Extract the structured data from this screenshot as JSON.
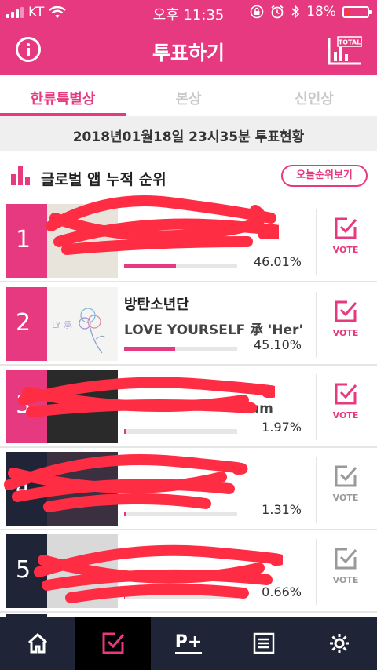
{
  "status_bar": {
    "carrier": "KT",
    "time": "오후 11:35",
    "battery": "18%"
  },
  "header": {
    "title": "투표하기",
    "total_label": "TOTAL"
  },
  "tabs": [
    {
      "label": "한류특별상",
      "active": true
    },
    {
      "label": "본상",
      "active": false
    },
    {
      "label": "신인상",
      "active": false
    }
  ],
  "date_banner": "2018년01월18일 23시35분 투표현황",
  "section": {
    "title": "글로벌 앱 누적 순위",
    "today_button": "오늘순위보기"
  },
  "ranking": [
    {
      "rank": "1",
      "artist": "",
      "album": "",
      "percent": "46.01%",
      "value": 0.4601,
      "vote_label": "VOTE",
      "vote_active": true
    },
    {
      "rank": "2",
      "artist": "방탄소년단",
      "album": "LOVE YOURSELF 承 'Her'",
      "percent": "45.10%",
      "value": 0.451,
      "vote_label": "VOTE",
      "vote_active": true,
      "thumb_text": "LY 承"
    },
    {
      "rank": "3",
      "artist": "",
      "album": "um",
      "percent": "1.97%",
      "value": 0.0197,
      "vote_label": "VOTE",
      "vote_active": true
    },
    {
      "rank": "4",
      "artist": "",
      "album": "",
      "percent": "1.31%",
      "value": 0.0131,
      "vote_label": "VOTE",
      "vote_active": false
    },
    {
      "rank": "5",
      "artist": "",
      "album": "",
      "percent": "0.66%",
      "value": 0.0066,
      "vote_label": "VOTE",
      "vote_active": false
    }
  ],
  "bottom_nav": [
    {
      "name": "home",
      "icon": "home-icon",
      "active": false
    },
    {
      "name": "vote",
      "icon": "vote-check-icon",
      "active": true
    },
    {
      "name": "plus",
      "icon": "p-plus-icon",
      "label": "P+",
      "active": false
    },
    {
      "name": "list",
      "icon": "list-icon",
      "active": false
    },
    {
      "name": "settings",
      "icon": "gear-icon",
      "active": false
    }
  ],
  "colors": {
    "accent": "#e6397f",
    "dark": "#1f2537",
    "redaction": "#ff2d44"
  }
}
